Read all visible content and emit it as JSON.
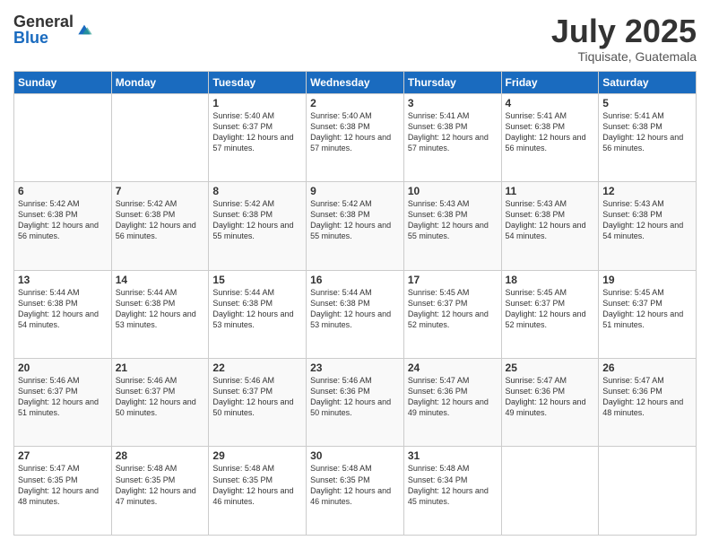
{
  "logo": {
    "general": "General",
    "blue": "Blue"
  },
  "header": {
    "month": "July 2025",
    "location": "Tiquisate, Guatemala"
  },
  "weekdays": [
    "Sunday",
    "Monday",
    "Tuesday",
    "Wednesday",
    "Thursday",
    "Friday",
    "Saturday"
  ],
  "weeks": [
    [
      {
        "day": "",
        "sunrise": "",
        "sunset": "",
        "daylight": ""
      },
      {
        "day": "",
        "sunrise": "",
        "sunset": "",
        "daylight": ""
      },
      {
        "day": "1",
        "sunrise": "Sunrise: 5:40 AM",
        "sunset": "Sunset: 6:37 PM",
        "daylight": "Daylight: 12 hours and 57 minutes."
      },
      {
        "day": "2",
        "sunrise": "Sunrise: 5:40 AM",
        "sunset": "Sunset: 6:38 PM",
        "daylight": "Daylight: 12 hours and 57 minutes."
      },
      {
        "day": "3",
        "sunrise": "Sunrise: 5:41 AM",
        "sunset": "Sunset: 6:38 PM",
        "daylight": "Daylight: 12 hours and 57 minutes."
      },
      {
        "day": "4",
        "sunrise": "Sunrise: 5:41 AM",
        "sunset": "Sunset: 6:38 PM",
        "daylight": "Daylight: 12 hours and 56 minutes."
      },
      {
        "day": "5",
        "sunrise": "Sunrise: 5:41 AM",
        "sunset": "Sunset: 6:38 PM",
        "daylight": "Daylight: 12 hours and 56 minutes."
      }
    ],
    [
      {
        "day": "6",
        "sunrise": "Sunrise: 5:42 AM",
        "sunset": "Sunset: 6:38 PM",
        "daylight": "Daylight: 12 hours and 56 minutes."
      },
      {
        "day": "7",
        "sunrise": "Sunrise: 5:42 AM",
        "sunset": "Sunset: 6:38 PM",
        "daylight": "Daylight: 12 hours and 56 minutes."
      },
      {
        "day": "8",
        "sunrise": "Sunrise: 5:42 AM",
        "sunset": "Sunset: 6:38 PM",
        "daylight": "Daylight: 12 hours and 55 minutes."
      },
      {
        "day": "9",
        "sunrise": "Sunrise: 5:42 AM",
        "sunset": "Sunset: 6:38 PM",
        "daylight": "Daylight: 12 hours and 55 minutes."
      },
      {
        "day": "10",
        "sunrise": "Sunrise: 5:43 AM",
        "sunset": "Sunset: 6:38 PM",
        "daylight": "Daylight: 12 hours and 55 minutes."
      },
      {
        "day": "11",
        "sunrise": "Sunrise: 5:43 AM",
        "sunset": "Sunset: 6:38 PM",
        "daylight": "Daylight: 12 hours and 54 minutes."
      },
      {
        "day": "12",
        "sunrise": "Sunrise: 5:43 AM",
        "sunset": "Sunset: 6:38 PM",
        "daylight": "Daylight: 12 hours and 54 minutes."
      }
    ],
    [
      {
        "day": "13",
        "sunrise": "Sunrise: 5:44 AM",
        "sunset": "Sunset: 6:38 PM",
        "daylight": "Daylight: 12 hours and 54 minutes."
      },
      {
        "day": "14",
        "sunrise": "Sunrise: 5:44 AM",
        "sunset": "Sunset: 6:38 PM",
        "daylight": "Daylight: 12 hours and 53 minutes."
      },
      {
        "day": "15",
        "sunrise": "Sunrise: 5:44 AM",
        "sunset": "Sunset: 6:38 PM",
        "daylight": "Daylight: 12 hours and 53 minutes."
      },
      {
        "day": "16",
        "sunrise": "Sunrise: 5:44 AM",
        "sunset": "Sunset: 6:38 PM",
        "daylight": "Daylight: 12 hours and 53 minutes."
      },
      {
        "day": "17",
        "sunrise": "Sunrise: 5:45 AM",
        "sunset": "Sunset: 6:37 PM",
        "daylight": "Daylight: 12 hours and 52 minutes."
      },
      {
        "day": "18",
        "sunrise": "Sunrise: 5:45 AM",
        "sunset": "Sunset: 6:37 PM",
        "daylight": "Daylight: 12 hours and 52 minutes."
      },
      {
        "day": "19",
        "sunrise": "Sunrise: 5:45 AM",
        "sunset": "Sunset: 6:37 PM",
        "daylight": "Daylight: 12 hours and 51 minutes."
      }
    ],
    [
      {
        "day": "20",
        "sunrise": "Sunrise: 5:46 AM",
        "sunset": "Sunset: 6:37 PM",
        "daylight": "Daylight: 12 hours and 51 minutes."
      },
      {
        "day": "21",
        "sunrise": "Sunrise: 5:46 AM",
        "sunset": "Sunset: 6:37 PM",
        "daylight": "Daylight: 12 hours and 50 minutes."
      },
      {
        "day": "22",
        "sunrise": "Sunrise: 5:46 AM",
        "sunset": "Sunset: 6:37 PM",
        "daylight": "Daylight: 12 hours and 50 minutes."
      },
      {
        "day": "23",
        "sunrise": "Sunrise: 5:46 AM",
        "sunset": "Sunset: 6:36 PM",
        "daylight": "Daylight: 12 hours and 50 minutes."
      },
      {
        "day": "24",
        "sunrise": "Sunrise: 5:47 AM",
        "sunset": "Sunset: 6:36 PM",
        "daylight": "Daylight: 12 hours and 49 minutes."
      },
      {
        "day": "25",
        "sunrise": "Sunrise: 5:47 AM",
        "sunset": "Sunset: 6:36 PM",
        "daylight": "Daylight: 12 hours and 49 minutes."
      },
      {
        "day": "26",
        "sunrise": "Sunrise: 5:47 AM",
        "sunset": "Sunset: 6:36 PM",
        "daylight": "Daylight: 12 hours and 48 minutes."
      }
    ],
    [
      {
        "day": "27",
        "sunrise": "Sunrise: 5:47 AM",
        "sunset": "Sunset: 6:35 PM",
        "daylight": "Daylight: 12 hours and 48 minutes."
      },
      {
        "day": "28",
        "sunrise": "Sunrise: 5:48 AM",
        "sunset": "Sunset: 6:35 PM",
        "daylight": "Daylight: 12 hours and 47 minutes."
      },
      {
        "day": "29",
        "sunrise": "Sunrise: 5:48 AM",
        "sunset": "Sunset: 6:35 PM",
        "daylight": "Daylight: 12 hours and 46 minutes."
      },
      {
        "day": "30",
        "sunrise": "Sunrise: 5:48 AM",
        "sunset": "Sunset: 6:35 PM",
        "daylight": "Daylight: 12 hours and 46 minutes."
      },
      {
        "day": "31",
        "sunrise": "Sunrise: 5:48 AM",
        "sunset": "Sunset: 6:34 PM",
        "daylight": "Daylight: 12 hours and 45 minutes."
      },
      {
        "day": "",
        "sunrise": "",
        "sunset": "",
        "daylight": ""
      },
      {
        "day": "",
        "sunrise": "",
        "sunset": "",
        "daylight": ""
      }
    ]
  ]
}
